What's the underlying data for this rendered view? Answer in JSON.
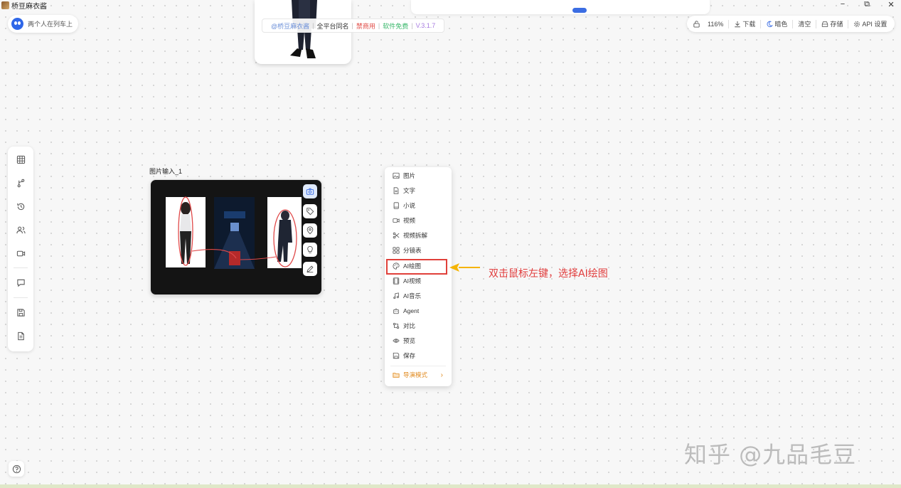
{
  "window": {
    "title": "桥豆麻衣酱",
    "controls": {
      "minimize": "−",
      "maximize": "⧉",
      "close": "✕"
    }
  },
  "user_chip": {
    "label": "两个人在列车上",
    "avatar_color": "#2f67e8"
  },
  "banner": {
    "handle": "@桥豆麻衣酱",
    "same_name": "全平台同名",
    "no_commercial": "禁商用",
    "free": "软件免费",
    "version": "V.3.1.7",
    "separator": "|"
  },
  "toolbar": {
    "lock_icon": "lock-icon",
    "zoom": "116%",
    "download": "下载",
    "theme": "暗色",
    "clear": "清空",
    "save": "存储",
    "api_settings": "API 设置"
  },
  "side_rail": [
    "grid-icon",
    "branch-icon",
    "history-icon",
    "users-icon",
    "video-icon",
    "chat-icon",
    "save-icon",
    "file-icon"
  ],
  "node": {
    "title": "图片输入_1"
  },
  "context_menu": {
    "items": [
      {
        "label": "图片",
        "icon": "image-icon"
      },
      {
        "label": "文字",
        "icon": "doc-icon"
      },
      {
        "label": "小说",
        "icon": "book-icon"
      },
      {
        "label": "视频",
        "icon": "video-icon"
      },
      {
        "label": "视频拆解",
        "icon": "scissors-icon"
      },
      {
        "label": "分镜表",
        "icon": "grid-icon"
      },
      {
        "label": "AI绘图",
        "icon": "palette-icon"
      },
      {
        "label": "AI视频",
        "icon": "film-icon"
      },
      {
        "label": "AI音乐",
        "icon": "music-icon"
      },
      {
        "label": "Agent",
        "icon": "robot-icon"
      },
      {
        "label": "对比",
        "icon": "compare-icon"
      },
      {
        "label": "预览",
        "icon": "eye-icon"
      },
      {
        "label": "保存",
        "icon": "save-icon"
      }
    ],
    "director": {
      "label": "导演模式",
      "icon": "folder-icon",
      "arrow": "›"
    }
  },
  "annotation": {
    "text": "双击鼠标左键，选择AI绘图",
    "color": "#e03b3b"
  },
  "watermark": "知乎 @九品毛豆",
  "colors": {
    "accent": "#2f67e8",
    "highlight": "#e0403a",
    "director": "#e08a1e"
  }
}
